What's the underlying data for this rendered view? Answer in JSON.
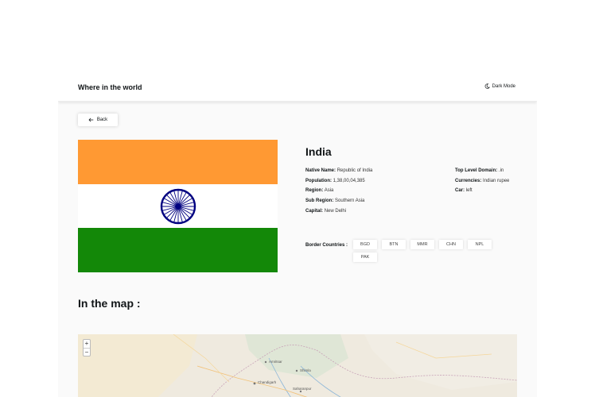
{
  "header": {
    "title": "Where in the world",
    "mode_toggle": {
      "label": "Dark Mode",
      "icon": "moon-icon"
    }
  },
  "back_button": {
    "label": "Back",
    "icon": "arrow-left-icon"
  },
  "flag": {
    "colors": {
      "top": "#ff9933",
      "middle": "#ffffff",
      "bottom": "#138808",
      "chakra": "#000080"
    }
  },
  "country": {
    "name": "India",
    "details_left": [
      {
        "label": "Native Name:",
        "value": "Republic of India"
      },
      {
        "label": "Population:",
        "value": "1,38,00,04,385"
      },
      {
        "label": "Region:",
        "value": "Asia"
      },
      {
        "label": "Sub Region:",
        "value": "Southern Asia"
      },
      {
        "label": "Capital:",
        "value": "New Delhi"
      }
    ],
    "details_right": [
      {
        "label": "Top Level Domain:",
        "value": ".in"
      },
      {
        "label": "Currencies:",
        "value": "Indian rupee"
      },
      {
        "label": "Car:",
        "value": "left"
      }
    ],
    "border_label": "Border Countries :",
    "borders": [
      "BGD",
      "BTN",
      "MMR",
      "CHN",
      "NPL",
      "PAK"
    ]
  },
  "map_section": {
    "heading": "In the map :",
    "zoom_in": "+",
    "zoom_out": "−",
    "labels": [
      "Chandigarh",
      "Saharanpur",
      "Amritsar",
      "Shimla"
    ]
  }
}
